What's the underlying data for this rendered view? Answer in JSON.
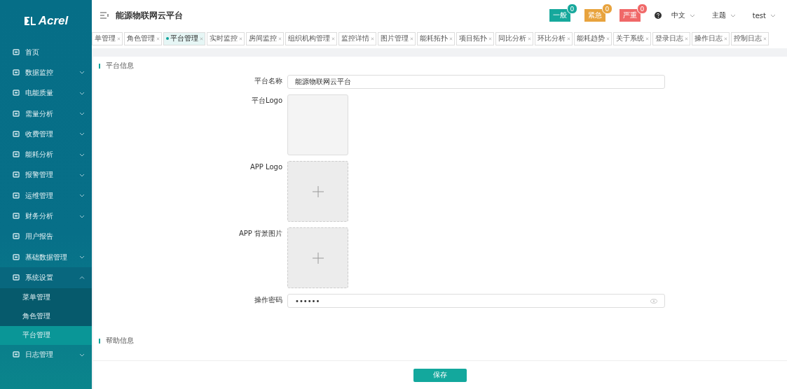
{
  "sidebar": {
    "brand": "Acrel",
    "items": [
      {
        "label": "首页",
        "kind": "link"
      },
      {
        "label": "数据监控",
        "kind": "group",
        "expanded": false
      },
      {
        "label": "电能质量",
        "kind": "group",
        "expanded": false
      },
      {
        "label": "需量分析",
        "kind": "group",
        "expanded": false
      },
      {
        "label": "收费管理",
        "kind": "group",
        "expanded": false
      },
      {
        "label": "能耗分析",
        "kind": "group",
        "expanded": false
      },
      {
        "label": "报警管理",
        "kind": "group",
        "expanded": false
      },
      {
        "label": "运维管理",
        "kind": "group",
        "expanded": false
      },
      {
        "label": "财务分析",
        "kind": "group",
        "expanded": false
      },
      {
        "label": "用户报告",
        "kind": "link"
      },
      {
        "label": "基础数据管理",
        "kind": "group",
        "expanded": false
      },
      {
        "label": "系统设置",
        "kind": "group",
        "expanded": true,
        "children": [
          {
            "label": "菜单管理",
            "selected": false
          },
          {
            "label": "角色管理",
            "selected": false
          },
          {
            "label": "平台管理",
            "selected": true
          }
        ]
      },
      {
        "label": "日志管理",
        "kind": "group",
        "expanded": false
      }
    ]
  },
  "header": {
    "title": "能源物联网云平台",
    "alerts": [
      {
        "label": "一般",
        "count": "0",
        "color": "#16a89c"
      },
      {
        "label": "紧急",
        "count": "0",
        "color": "#e8a33d"
      },
      {
        "label": "严重",
        "count": "0",
        "color": "#f06868"
      }
    ],
    "language": "中文",
    "theme": "主题",
    "user": "test"
  },
  "tabs": [
    {
      "label": "单管理",
      "selected": false
    },
    {
      "label": "角色管理",
      "selected": false
    },
    {
      "label": "平台管理",
      "selected": true
    },
    {
      "label": "实时监控",
      "selected": false
    },
    {
      "label": "房间监控",
      "selected": false
    },
    {
      "label": "组织机构管理",
      "selected": false
    },
    {
      "label": "监控详情",
      "selected": false
    },
    {
      "label": "图片管理",
      "selected": false
    },
    {
      "label": "能耗拓扑",
      "selected": false
    },
    {
      "label": "项目拓扑",
      "selected": false
    },
    {
      "label": "同比分析",
      "selected": false
    },
    {
      "label": "环比分析",
      "selected": false
    },
    {
      "label": "能耗趋势",
      "selected": false
    },
    {
      "label": "关于系统",
      "selected": false
    },
    {
      "label": "登录日志",
      "selected": false
    },
    {
      "label": "操作日志",
      "selected": false
    },
    {
      "label": "控制日志",
      "selected": false
    }
  ],
  "section_title": "平台信息",
  "form": [
    {
      "kind": "text",
      "label": "平台名称",
      "value": "能源物联网云平台"
    },
    {
      "kind": "image",
      "label": "平台Logo"
    },
    {
      "kind": "upload",
      "label": "APP Logo"
    },
    {
      "kind": "upload",
      "label": "APP 背景图片"
    },
    {
      "kind": "password",
      "label": "操作密码",
      "value": "••••••"
    }
  ],
  "help_title": "帮助信息",
  "save_button": "保存"
}
